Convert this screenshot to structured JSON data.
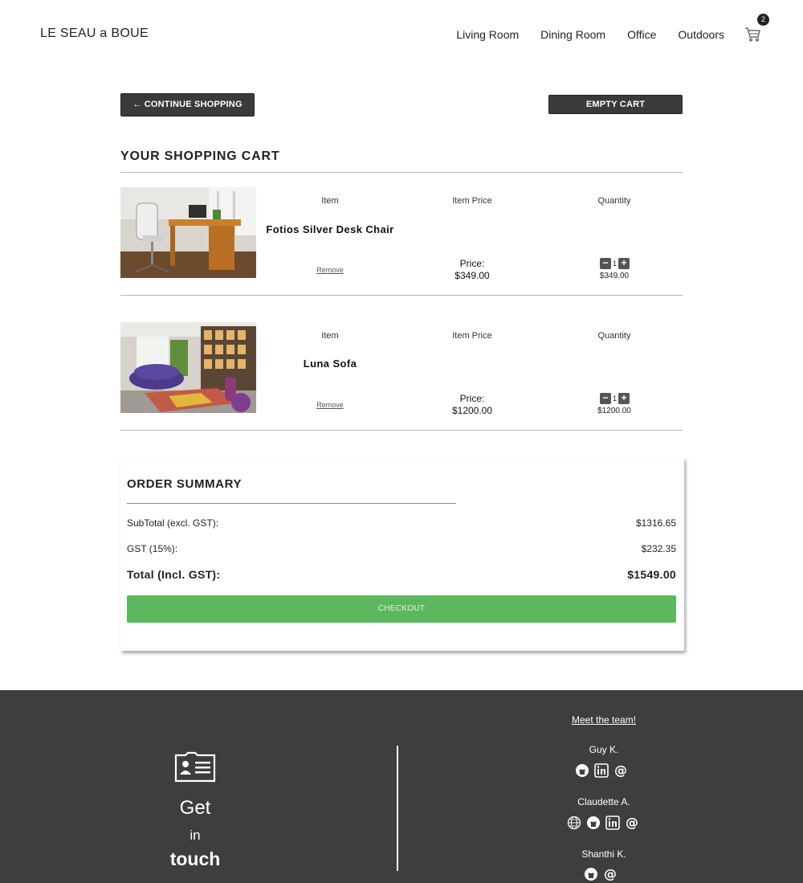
{
  "header": {
    "brand": "LE SEAU a BOUE",
    "nav": [
      "Living Room",
      "Dining Room",
      "Office",
      "Outdoors"
    ],
    "cart_count": "2"
  },
  "buttons": {
    "continue": "← CONTINUE SHOPPING",
    "empty": "EMPTY CART"
  },
  "cart": {
    "title": "YOUR SHOPPING CART",
    "col_item": "Item",
    "col_price": "Item Price",
    "col_qty": "Quantity",
    "price_label": "Price:",
    "remove_label": "Remove",
    "items": [
      {
        "name": "Fotios Silver Desk Chair",
        "price": "$349.00",
        "qty": "1",
        "line_total": "$349.00"
      },
      {
        "name": "Luna Sofa",
        "price": "$1200.00",
        "qty": "1",
        "line_total": "$1200.00"
      }
    ]
  },
  "summary": {
    "title": "ORDER SUMMARY",
    "subtotal_label": "SubTotal (excl. GST):",
    "subtotal_value": "$1316.65",
    "gst_label": "GST (15%):",
    "gst_value": "$232.35",
    "total_label": "Total (Incl. GST):",
    "total_value": "$1549.00",
    "checkout": "CHECKOUT"
  },
  "footer": {
    "get": "Get",
    "in": "in",
    "touch": "touch",
    "meet": "Meet the team!",
    "members": [
      {
        "name": "Guy K.",
        "icons": [
          "github-icon",
          "linkedin-icon",
          "email-icon"
        ]
      },
      {
        "name": "Claudette A.",
        "icons": [
          "globe-icon",
          "github-icon",
          "linkedin-icon",
          "email-icon"
        ]
      },
      {
        "name": "Shanthi K.",
        "icons": [
          "github-icon",
          "email-icon"
        ]
      }
    ]
  },
  "colors": {
    "checkout_green": "#5cb85c",
    "footer_bg": "#3e3e3e",
    "dark_button": "#3a3a3a"
  }
}
